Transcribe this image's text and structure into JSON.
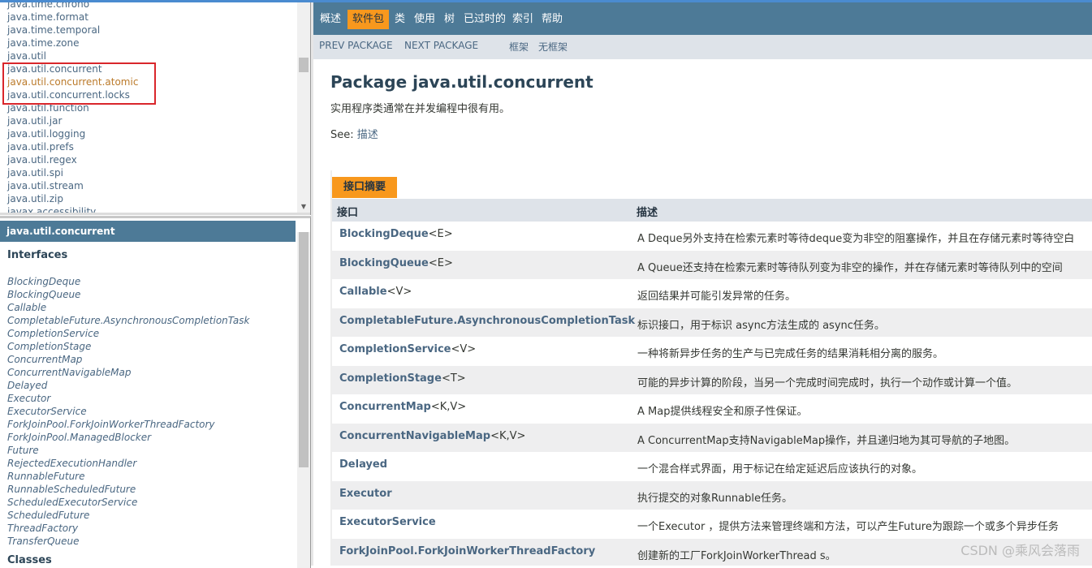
{
  "packages": [
    "java.time.chrono",
    "java.time.format",
    "java.time.temporal",
    "java.time.zone",
    "java.util",
    "java.util.concurrent",
    "java.util.concurrent.atomic",
    "java.util.concurrent.locks",
    "java.util.function",
    "java.util.jar",
    "java.util.logging",
    "java.util.prefs",
    "java.util.regex",
    "java.util.spi",
    "java.util.stream",
    "java.util.zip",
    "javax.accessibility"
  ],
  "left_bottom": {
    "package_name": "java.util.concurrent",
    "interfaces_heading": "Interfaces",
    "classes_heading": "Classes",
    "interfaces": [
      "BlockingDeque",
      "BlockingQueue",
      "Callable",
      "CompletableFuture.AsynchronousCompletionTask",
      "CompletionService",
      "CompletionStage",
      "ConcurrentMap",
      "ConcurrentNavigableMap",
      "Delayed",
      "Executor",
      "ExecutorService",
      "ForkJoinPool.ForkJoinWorkerThreadFactory",
      "ForkJoinPool.ManagedBlocker",
      "Future",
      "RejectedExecutionHandler",
      "RunnableFuture",
      "RunnableScheduledFuture",
      "ScheduledExecutorService",
      "ScheduledFuture",
      "ThreadFactory",
      "TransferQueue"
    ]
  },
  "navbar": {
    "overview": "概述",
    "package": "软件包",
    "class": "类",
    "use": "使用",
    "tree": "树",
    "deprecated": "已过时的",
    "index": "索引",
    "help": "帮助"
  },
  "subnav": {
    "prev": "PREV PACKAGE",
    "next": "NEXT PACKAGE",
    "frames": "框架",
    "noframes": "无框架"
  },
  "content": {
    "title": "Package java.util.concurrent",
    "description": "实用程序类通常在并发编程中很有用。",
    "see_label": "See: ",
    "see_link": "描述",
    "summary_tab": "接口摘要",
    "col_interface": "接口",
    "col_description": "描述",
    "rows": [
      {
        "name": "BlockingDeque",
        "generic": "<E>",
        "desc": "A Deque另外支持在检索元素时等待deque变为非空的阻塞操作，并且在存储元素时等待空白"
      },
      {
        "name": "BlockingQueue",
        "generic": "<E>",
        "desc": "A Queue还支持在检索元素时等待队列变为非空的操作，并在存储元素时等待队列中的空间"
      },
      {
        "name": "Callable",
        "generic": "<V>",
        "desc": "返回结果并可能引发异常的任务。"
      },
      {
        "name": "CompletableFuture.AsynchronousCompletionTask",
        "generic": "",
        "desc": "标识接口，用于标识 async方法生成的 async任务。"
      },
      {
        "name": "CompletionService",
        "generic": "<V>",
        "desc": "一种将新异步任务的生产与已完成任务的结果消耗相分离的服务。"
      },
      {
        "name": "CompletionStage",
        "generic": "<T>",
        "desc": "可能的异步计算的阶段，当另一个完成时间完成时，执行一个动作或计算一个值。"
      },
      {
        "name": "ConcurrentMap",
        "generic": "<K,V>",
        "desc": "A Map提供线程安全和原子性保证。"
      },
      {
        "name": "ConcurrentNavigableMap",
        "generic": "<K,V>",
        "desc": "A ConcurrentMap支持NavigableMap操作，并且递归地为其可导航的子地图。"
      },
      {
        "name": "Delayed",
        "generic": "",
        "desc": "一个混合样式界面，用于标记在给定延迟后应该执行的对象。"
      },
      {
        "name": "Executor",
        "generic": "",
        "desc": "执行提交的对象Runnable任务。"
      },
      {
        "name": "ExecutorService",
        "generic": "",
        "desc": "一个Executor ，提供方法来管理终端和方法，可以产生Future为跟踪一个或多个异步任务"
      },
      {
        "name": "ForkJoinPool.ForkJoinWorkerThreadFactory",
        "generic": "",
        "desc": "创建新的工厂ForkJoinWorkerThread s。"
      }
    ]
  },
  "watermark": "CSDN @乘风会落雨"
}
